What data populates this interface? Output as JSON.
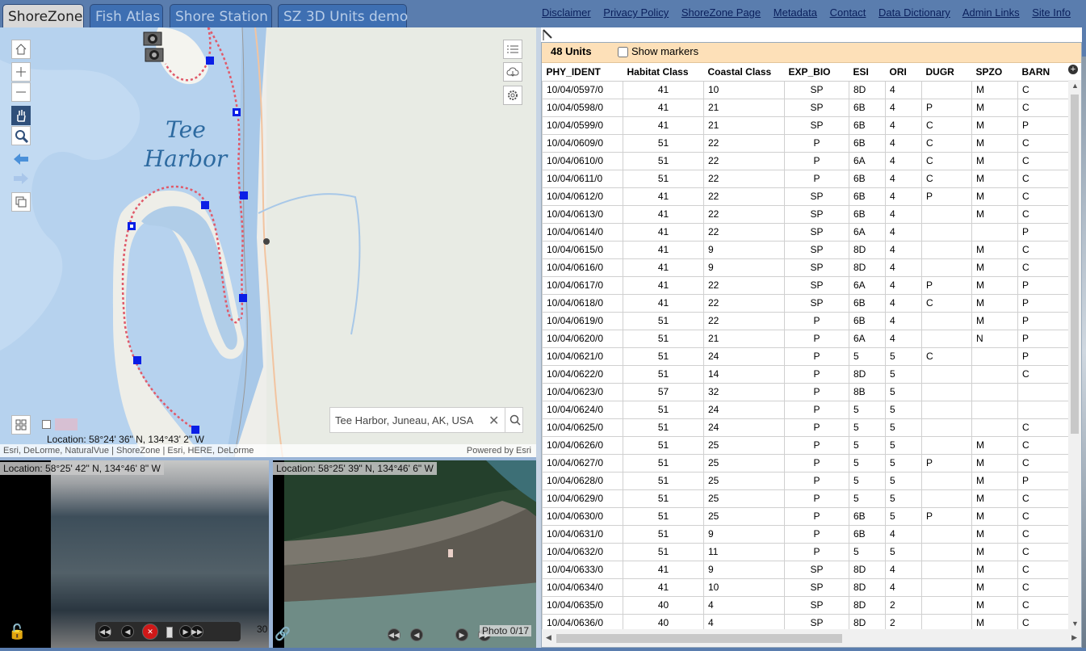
{
  "tabs": [
    "ShoreZone",
    "Fish Atlas",
    "Shore Station",
    "SZ 3D Units demo"
  ],
  "header_links": [
    "Disclaimer",
    "Privacy Policy",
    "ShoreZone Page",
    "Metadata",
    "Contact",
    "Data Dictionary",
    "Admin Links",
    "Site Info"
  ],
  "map": {
    "place_label_1": "Tee",
    "place_label_2": "Harbor",
    "search_value": "Tee Harbor, Juneau, AK, USA",
    "location": "Location: 58°24' 36\" N, 134°43' 2\" W",
    "attribution": "Esri, DeLorme, NaturalVue | ShoreZone | Esri, HERE, DeLorme",
    "powered_by": "Powered by Esri"
  },
  "video": {
    "location": "Location: 58°25' 42\" N, 134°46' 8\" W",
    "frame_text": "30"
  },
  "photo": {
    "location": "Location: 58°25' 39\" N, 134°46' 6\" W",
    "counter": "Photo 0/17"
  },
  "units": {
    "count_label": "48 Units",
    "show_markers_label": "Show markers",
    "columns": [
      "PHY_IDENT",
      "Habitat Class",
      "Coastal Class",
      "EXP_BIO",
      "ESI",
      "ORI",
      "DUGR",
      "SPZO",
      "BARN"
    ],
    "rows": [
      [
        "10/04/0597/0",
        "41",
        "10",
        "SP",
        "8D",
        "4",
        "",
        "M",
        "C"
      ],
      [
        "10/04/0598/0",
        "41",
        "21",
        "SP",
        "6B",
        "4",
        "P",
        "M",
        "C"
      ],
      [
        "10/04/0599/0",
        "41",
        "21",
        "SP",
        "6B",
        "4",
        "C",
        "M",
        "P"
      ],
      [
        "10/04/0609/0",
        "51",
        "22",
        "P",
        "6B",
        "4",
        "C",
        "M",
        "C"
      ],
      [
        "10/04/0610/0",
        "51",
        "22",
        "P",
        "6A",
        "4",
        "C",
        "M",
        "C"
      ],
      [
        "10/04/0611/0",
        "51",
        "22",
        "P",
        "6B",
        "4",
        "C",
        "M",
        "C"
      ],
      [
        "10/04/0612/0",
        "41",
        "22",
        "SP",
        "6B",
        "4",
        "P",
        "M",
        "C"
      ],
      [
        "10/04/0613/0",
        "41",
        "22",
        "SP",
        "6B",
        "4",
        "",
        "M",
        "C"
      ],
      [
        "10/04/0614/0",
        "41",
        "22",
        "SP",
        "6A",
        "4",
        "",
        "",
        "P"
      ],
      [
        "10/04/0615/0",
        "41",
        "9",
        "SP",
        "8D",
        "4",
        "",
        "M",
        "C"
      ],
      [
        "10/04/0616/0",
        "41",
        "9",
        "SP",
        "8D",
        "4",
        "",
        "M",
        "C"
      ],
      [
        "10/04/0617/0",
        "41",
        "22",
        "SP",
        "6A",
        "4",
        "P",
        "M",
        "P"
      ],
      [
        "10/04/0618/0",
        "41",
        "22",
        "SP",
        "6B",
        "4",
        "C",
        "M",
        "P"
      ],
      [
        "10/04/0619/0",
        "51",
        "22",
        "P",
        "6B",
        "4",
        "",
        "M",
        "P"
      ],
      [
        "10/04/0620/0",
        "51",
        "21",
        "P",
        "6A",
        "4",
        "",
        "N",
        "P"
      ],
      [
        "10/04/0621/0",
        "51",
        "24",
        "P",
        "5",
        "5",
        "C",
        "",
        "P"
      ],
      [
        "10/04/0622/0",
        "51",
        "14",
        "P",
        "8D",
        "5",
        "",
        "",
        "C"
      ],
      [
        "10/04/0623/0",
        "57",
        "32",
        "P",
        "8B",
        "5",
        "",
        "",
        ""
      ],
      [
        "10/04/0624/0",
        "51",
        "24",
        "P",
        "5",
        "5",
        "",
        "",
        ""
      ],
      [
        "10/04/0625/0",
        "51",
        "24",
        "P",
        "5",
        "5",
        "",
        "",
        "C"
      ],
      [
        "10/04/0626/0",
        "51",
        "25",
        "P",
        "5",
        "5",
        "",
        "M",
        "C"
      ],
      [
        "10/04/0627/0",
        "51",
        "25",
        "P",
        "5",
        "5",
        "P",
        "M",
        "C"
      ],
      [
        "10/04/0628/0",
        "51",
        "25",
        "P",
        "5",
        "5",
        "",
        "M",
        "P"
      ],
      [
        "10/04/0629/0",
        "51",
        "25",
        "P",
        "5",
        "5",
        "",
        "M",
        "C"
      ],
      [
        "10/04/0630/0",
        "51",
        "25",
        "P",
        "6B",
        "5",
        "P",
        "M",
        "C"
      ],
      [
        "10/04/0631/0",
        "51",
        "9",
        "P",
        "6B",
        "4",
        "",
        "M",
        "C"
      ],
      [
        "10/04/0632/0",
        "51",
        "11",
        "P",
        "5",
        "5",
        "",
        "M",
        "C"
      ],
      [
        "10/04/0633/0",
        "41",
        "9",
        "SP",
        "8D",
        "4",
        "",
        "M",
        "C"
      ],
      [
        "10/04/0634/0",
        "41",
        "10",
        "SP",
        "8D",
        "4",
        "",
        "M",
        "C"
      ],
      [
        "10/04/0635/0",
        "40",
        "4",
        "SP",
        "8D",
        "2",
        "",
        "M",
        "C"
      ],
      [
        "10/04/0636/0",
        "40",
        "4",
        "SP",
        "8D",
        "2",
        "",
        "M",
        "C"
      ]
    ]
  },
  "colors": {
    "header_bg": "#5a7dae",
    "units_bar_bg": "#fde0b8",
    "water": "#a8c8e8",
    "segment_line": "#e05a6a",
    "unit_marker": "#0a1ee6"
  }
}
